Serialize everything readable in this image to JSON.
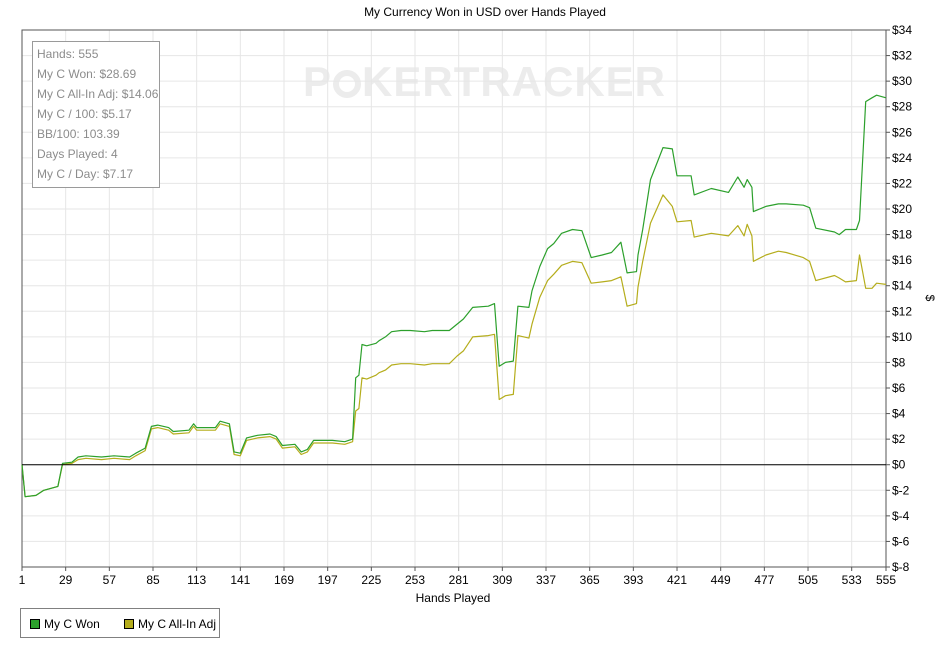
{
  "watermark": {
    "left": "P",
    "right": "KERTRACKER"
  },
  "stats": [
    "Hands: 555",
    "My C Won: $28.69",
    "My C All-In Adj: $14.06",
    "My C / 100: $5.17",
    "BB/100: 103.39",
    "Days Played: 4",
    "My C / Day: $7.17"
  ],
  "legend": [
    {
      "label": "My C Won",
      "color": "#2ca02c"
    },
    {
      "label": "My C All-In Adj",
      "color": "#b5ad1c"
    }
  ],
  "chart_data": {
    "type": "line",
    "title": "My Currency Won in USD over Hands Played",
    "xlabel": "Hands Played",
    "ylabel": "$",
    "xlim": [
      1,
      555
    ],
    "ylim": [
      -8,
      34
    ],
    "x_ticks": [
      "1",
      "29",
      "57",
      "85",
      "113",
      "141",
      "169",
      "197",
      "225",
      "253",
      "281",
      "309",
      "337",
      "365",
      "393",
      "421",
      "449",
      "477",
      "505",
      "533",
      "555"
    ],
    "y_ticks": [
      "$-8",
      "$-6",
      "$-4",
      "$-2",
      "$0",
      "$2",
      "$4",
      "$6",
      "$8",
      "$10",
      "$12",
      "$14",
      "$16",
      "$18",
      "$20",
      "$22",
      "$24",
      "$26",
      "$28",
      "$30",
      "$32",
      "$34"
    ],
    "y_tick_values": [
      -8,
      -6,
      -4,
      -2,
      0,
      2,
      4,
      6,
      8,
      10,
      12,
      14,
      16,
      18,
      20,
      22,
      24,
      26,
      28,
      30,
      32,
      34
    ],
    "grid": true,
    "legend_position": "bottom-left",
    "series": [
      {
        "name": "My C Won",
        "color": "#2ca02c",
        "points": [
          [
            1,
            0
          ],
          [
            3,
            -2.5
          ],
          [
            10,
            -2.4
          ],
          [
            15,
            -2.0
          ],
          [
            24,
            -1.7
          ],
          [
            27,
            0.1
          ],
          [
            33,
            0.2
          ],
          [
            37,
            0.6
          ],
          [
            42,
            0.7
          ],
          [
            52,
            0.6
          ],
          [
            60,
            0.7
          ],
          [
            70,
            0.6
          ],
          [
            74,
            0.9
          ],
          [
            80,
            1.3
          ],
          [
            84,
            3.0
          ],
          [
            88,
            3.1
          ],
          [
            95,
            2.9
          ],
          [
            98,
            2.6
          ],
          [
            108,
            2.7
          ],
          [
            111,
            3.2
          ],
          [
            113,
            2.9
          ],
          [
            125,
            2.9
          ],
          [
            128,
            3.4
          ],
          [
            134,
            3.2
          ],
          [
            137,
            1.0
          ],
          [
            141,
            0.9
          ],
          [
            145,
            2.1
          ],
          [
            152,
            2.3
          ],
          [
            160,
            2.4
          ],
          [
            164,
            2.2
          ],
          [
            168,
            1.5
          ],
          [
            176,
            1.6
          ],
          [
            180,
            1.0
          ],
          [
            184,
            1.2
          ],
          [
            188,
            1.9
          ],
          [
            200,
            1.9
          ],
          [
            208,
            1.8
          ],
          [
            213,
            2.0
          ],
          [
            215,
            6.8
          ],
          [
            217,
            7.0
          ],
          [
            219,
            9.4
          ],
          [
            222,
            9.3
          ],
          [
            228,
            9.5
          ],
          [
            230,
            9.7
          ],
          [
            234,
            10.0
          ],
          [
            238,
            10.4
          ],
          [
            244,
            10.5
          ],
          [
            250,
            10.5
          ],
          [
            259,
            10.4
          ],
          [
            264,
            10.5
          ],
          [
            275,
            10.5
          ],
          [
            280,
            11.0
          ],
          [
            284,
            11.4
          ],
          [
            290,
            12.3
          ],
          [
            300,
            12.4
          ],
          [
            304,
            12.6
          ],
          [
            307,
            7.7
          ],
          [
            311,
            8.0
          ],
          [
            316,
            8.1
          ],
          [
            319,
            12.4
          ],
          [
            326,
            12.3
          ],
          [
            328,
            13.6
          ],
          [
            333,
            15.5
          ],
          [
            338,
            16.9
          ],
          [
            342,
            17.3
          ],
          [
            347,
            18.1
          ],
          [
            354,
            18.4
          ],
          [
            360,
            18.3
          ],
          [
            366,
            16.2
          ],
          [
            373,
            16.4
          ],
          [
            379,
            16.6
          ],
          [
            385,
            17.4
          ],
          [
            389,
            15.0
          ],
          [
            395,
            15.1
          ],
          [
            396,
            16.4
          ],
          [
            399,
            18.4
          ],
          [
            404,
            22.3
          ],
          [
            412,
            24.8
          ],
          [
            418,
            24.7
          ],
          [
            421,
            22.6
          ],
          [
            430,
            22.6
          ],
          [
            432,
            21.1
          ],
          [
            443,
            21.6
          ],
          [
            454,
            21.3
          ],
          [
            460,
            22.5
          ],
          [
            464,
            21.7
          ],
          [
            466,
            22.3
          ],
          [
            469,
            21.7
          ],
          [
            470,
            19.8
          ],
          [
            478,
            20.2
          ],
          [
            486,
            20.4
          ],
          [
            491,
            20.4
          ],
          [
            502,
            20.3
          ],
          [
            506,
            20.1
          ],
          [
            510,
            18.5
          ],
          [
            522,
            18.2
          ],
          [
            525,
            18.0
          ],
          [
            529,
            18.4
          ],
          [
            536,
            18.4
          ],
          [
            538,
            19.1
          ],
          [
            542,
            28.4
          ],
          [
            546,
            28.7
          ],
          [
            549,
            28.9
          ],
          [
            555,
            28.7
          ]
        ]
      },
      {
        "name": "My C All-In Adj",
        "color": "#b5ad1c",
        "points": [
          [
            1,
            0
          ],
          [
            3,
            -2.5
          ],
          [
            10,
            -2.4
          ],
          [
            15,
            -2.0
          ],
          [
            24,
            -1.7
          ],
          [
            27,
            0.0
          ],
          [
            33,
            0.1
          ],
          [
            37,
            0.4
          ],
          [
            42,
            0.5
          ],
          [
            52,
            0.4
          ],
          [
            60,
            0.5
          ],
          [
            70,
            0.4
          ],
          [
            74,
            0.7
          ],
          [
            80,
            1.1
          ],
          [
            84,
            2.8
          ],
          [
            88,
            2.9
          ],
          [
            95,
            2.7
          ],
          [
            98,
            2.4
          ],
          [
            108,
            2.5
          ],
          [
            111,
            3.0
          ],
          [
            113,
            2.7
          ],
          [
            125,
            2.7
          ],
          [
            128,
            3.2
          ],
          [
            134,
            3.0
          ],
          [
            137,
            0.8
          ],
          [
            141,
            0.7
          ],
          [
            145,
            1.9
          ],
          [
            152,
            2.1
          ],
          [
            160,
            2.2
          ],
          [
            164,
            2.0
          ],
          [
            168,
            1.3
          ],
          [
            176,
            1.4
          ],
          [
            180,
            0.8
          ],
          [
            184,
            1.0
          ],
          [
            188,
            1.7
          ],
          [
            200,
            1.7
          ],
          [
            208,
            1.6
          ],
          [
            213,
            1.8
          ],
          [
            215,
            4.2
          ],
          [
            217,
            4.4
          ],
          [
            219,
            6.8
          ],
          [
            222,
            6.7
          ],
          [
            228,
            7.0
          ],
          [
            230,
            7.2
          ],
          [
            234,
            7.4
          ],
          [
            238,
            7.8
          ],
          [
            244,
            7.9
          ],
          [
            250,
            7.9
          ],
          [
            259,
            7.8
          ],
          [
            264,
            7.9
          ],
          [
            275,
            7.9
          ],
          [
            280,
            8.5
          ],
          [
            284,
            8.9
          ],
          [
            290,
            10.0
          ],
          [
            300,
            10.1
          ],
          [
            304,
            10.2
          ],
          [
            307,
            5.1
          ],
          [
            311,
            5.4
          ],
          [
            316,
            5.5
          ],
          [
            319,
            10.1
          ],
          [
            326,
            9.9
          ],
          [
            328,
            11.0
          ],
          [
            333,
            13.1
          ],
          [
            338,
            14.4
          ],
          [
            342,
            14.9
          ],
          [
            347,
            15.6
          ],
          [
            354,
            15.9
          ],
          [
            360,
            15.8
          ],
          [
            366,
            14.2
          ],
          [
            373,
            14.3
          ],
          [
            379,
            14.4
          ],
          [
            385,
            14.7
          ],
          [
            389,
            12.4
          ],
          [
            395,
            12.6
          ],
          [
            396,
            13.9
          ],
          [
            399,
            15.9
          ],
          [
            404,
            18.9
          ],
          [
            412,
            21.1
          ],
          [
            418,
            20.2
          ],
          [
            421,
            19.0
          ],
          [
            430,
            19.1
          ],
          [
            432,
            17.8
          ],
          [
            443,
            18.1
          ],
          [
            454,
            17.9
          ],
          [
            460,
            18.7
          ],
          [
            464,
            17.9
          ],
          [
            466,
            18.8
          ],
          [
            469,
            17.9
          ],
          [
            470,
            15.9
          ],
          [
            478,
            16.4
          ],
          [
            486,
            16.7
          ],
          [
            491,
            16.6
          ],
          [
            502,
            16.2
          ],
          [
            506,
            15.9
          ],
          [
            510,
            14.4
          ],
          [
            522,
            14.8
          ],
          [
            525,
            14.6
          ],
          [
            529,
            14.3
          ],
          [
            536,
            14.4
          ],
          [
            538,
            16.4
          ],
          [
            542,
            13.8
          ],
          [
            546,
            13.8
          ],
          [
            549,
            14.2
          ],
          [
            555,
            14.1
          ]
        ]
      }
    ]
  }
}
